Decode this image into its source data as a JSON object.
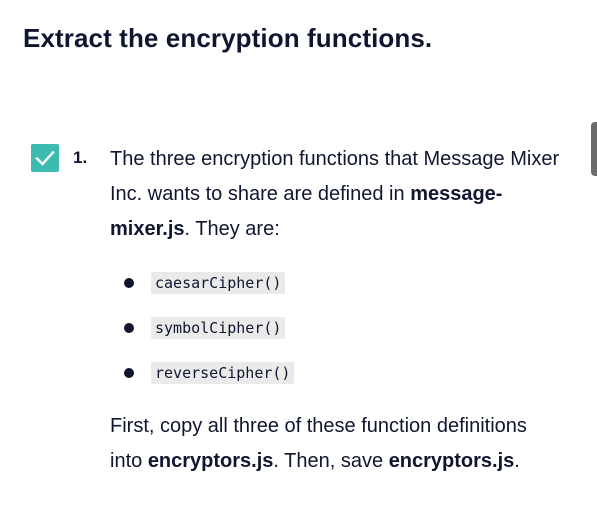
{
  "page": {
    "title": "Extract the encryption functions."
  },
  "task": {
    "number": "1.",
    "completed": true,
    "checkbox_icon": "check-icon",
    "intro_text_1": "The three encryption functions that Message Mixer Inc. wants to share are defined in ",
    "intro_file": "message-mixer.js",
    "intro_text_2": ". They are:",
    "functions": [
      "caesarCipher()",
      "symbolCipher()",
      "reverseCipher()"
    ],
    "outro_text_1": "First, copy all three of these function definitions into ",
    "outro_file_1": "encryptors.js",
    "outro_text_2": ". Then, save ",
    "outro_file_2": "encryptors.js",
    "outro_text_3": "."
  },
  "colors": {
    "checkbox": "#3cbcb0",
    "text": "#10162f",
    "code_bg": "#eaeaea"
  }
}
